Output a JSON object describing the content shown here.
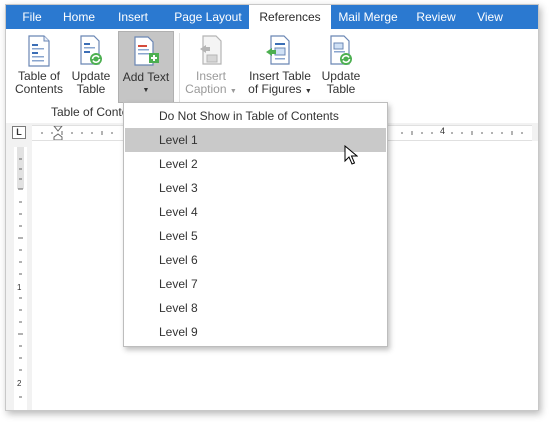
{
  "tabs": [
    {
      "label": "File",
      "active": false
    },
    {
      "label": "Home",
      "active": false
    },
    {
      "label": "Insert",
      "active": false
    },
    {
      "label": "Page Layout",
      "active": false
    },
    {
      "label": "References",
      "active": true
    },
    {
      "label": "Mail Merge",
      "active": false
    },
    {
      "label": "Review",
      "active": false
    },
    {
      "label": "View",
      "active": false
    }
  ],
  "ribbon": {
    "toc_line1": "Table of",
    "toc_line2": "Contents",
    "update_line1": "Update",
    "update_line2": "Table",
    "addtext_line1": "Add Text",
    "caption_line1": "Insert",
    "caption_line2": "Caption",
    "figures_line1": "Insert Table",
    "figures_line2": "of Figures",
    "update2_line1": "Update",
    "update2_line2": "Table",
    "group_label": "Table of Conte"
  },
  "ruler": {
    "corner": "L",
    "mark4": "4",
    "vmark1": "1",
    "vmark2": "2"
  },
  "dropdown": {
    "items": [
      "Do Not Show in Table of Contents",
      "Level 1",
      "Level 2",
      "Level 3",
      "Level 4",
      "Level 5",
      "Level 6",
      "Level 7",
      "Level 8",
      "Level 9"
    ],
    "hover_index": 1
  },
  "colors": {
    "tabbar": "#2b79d0",
    "pressed": "#c5c5c5",
    "hover": "#c9c9c9"
  }
}
